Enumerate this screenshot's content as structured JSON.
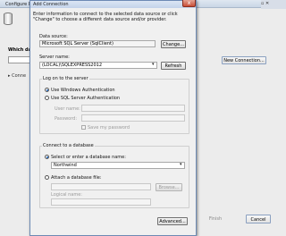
{
  "background": {
    "title": "Configure Data",
    "which_label": "Which da",
    "connection_expander": "Conne",
    "new_connection_label": "New Connection...",
    "finish_label": "Finish",
    "cancel_label": "Cancel"
  },
  "dialog": {
    "title": "Add Connection",
    "close_label": "x",
    "instructions": "Enter information to connect to the selected data source or click \"Change\" to choose a different data source and/or provider.",
    "data_source_label": "Data source:",
    "data_source_value": "Microsoft SQL Server (SqlClient)",
    "change_label": "Change...",
    "server_name_label": "Server name:",
    "server_name_value": "(LOCAL)\\SQLEXPRESS2012",
    "refresh_label": "Refresh",
    "logon_group_label": "Log on to the server",
    "windows_auth_label": "Use Windows Authentication",
    "sql_auth_label": "Use SQL Server Authentication",
    "user_name_label": "User name:",
    "password_label": "Password:",
    "save_password_label": "Save my password",
    "db_group_label": "Connect to a database",
    "select_db_label": "Select or enter a database name:",
    "database_value": "Northwind",
    "attach_label": "Attach a database file:",
    "browse_label": "Browse...",
    "logical_name_label": "Logical name:",
    "advanced_label": "Advanced..."
  }
}
